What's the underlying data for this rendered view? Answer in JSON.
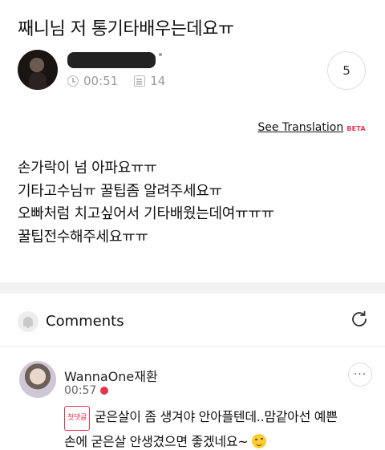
{
  "post": {
    "title": "째니님 저 통기타배우는데요ㅠ",
    "time": "00:51",
    "views": "14",
    "like_count": "5",
    "translation_label": "See Translation",
    "translation_badge": "BETA",
    "body_lines": [
      "손가락이 넘 아파요ㅠㅠ",
      "기타고수님ㅠ 꿀팁좀 알려주세요ㅠ",
      "오빠처럼 치고싶어서 기타배웠는데여ㅠㅠㅠ",
      "꿀팁전수해주세요ㅠㅠ"
    ]
  },
  "comments_section": {
    "label": "Comments"
  },
  "comment": {
    "author": "WannaOne재환",
    "time": "00:57",
    "first_badge": "첫댓글",
    "text_line1": "굳은살이 좀 생겨야 안아플텐데..맘같아선 예쁜",
    "text_line2": "손에 굳은살 안생겼으면 좋겠네요~",
    "more_label": "···"
  },
  "colors": {
    "accent": "#e8344e",
    "muted": "#999999",
    "divider": "#f2f2f2"
  },
  "icons": [
    "clock-icon",
    "document-icon",
    "bell-icon",
    "refresh-icon",
    "more-icon",
    "wink-emoji"
  ]
}
